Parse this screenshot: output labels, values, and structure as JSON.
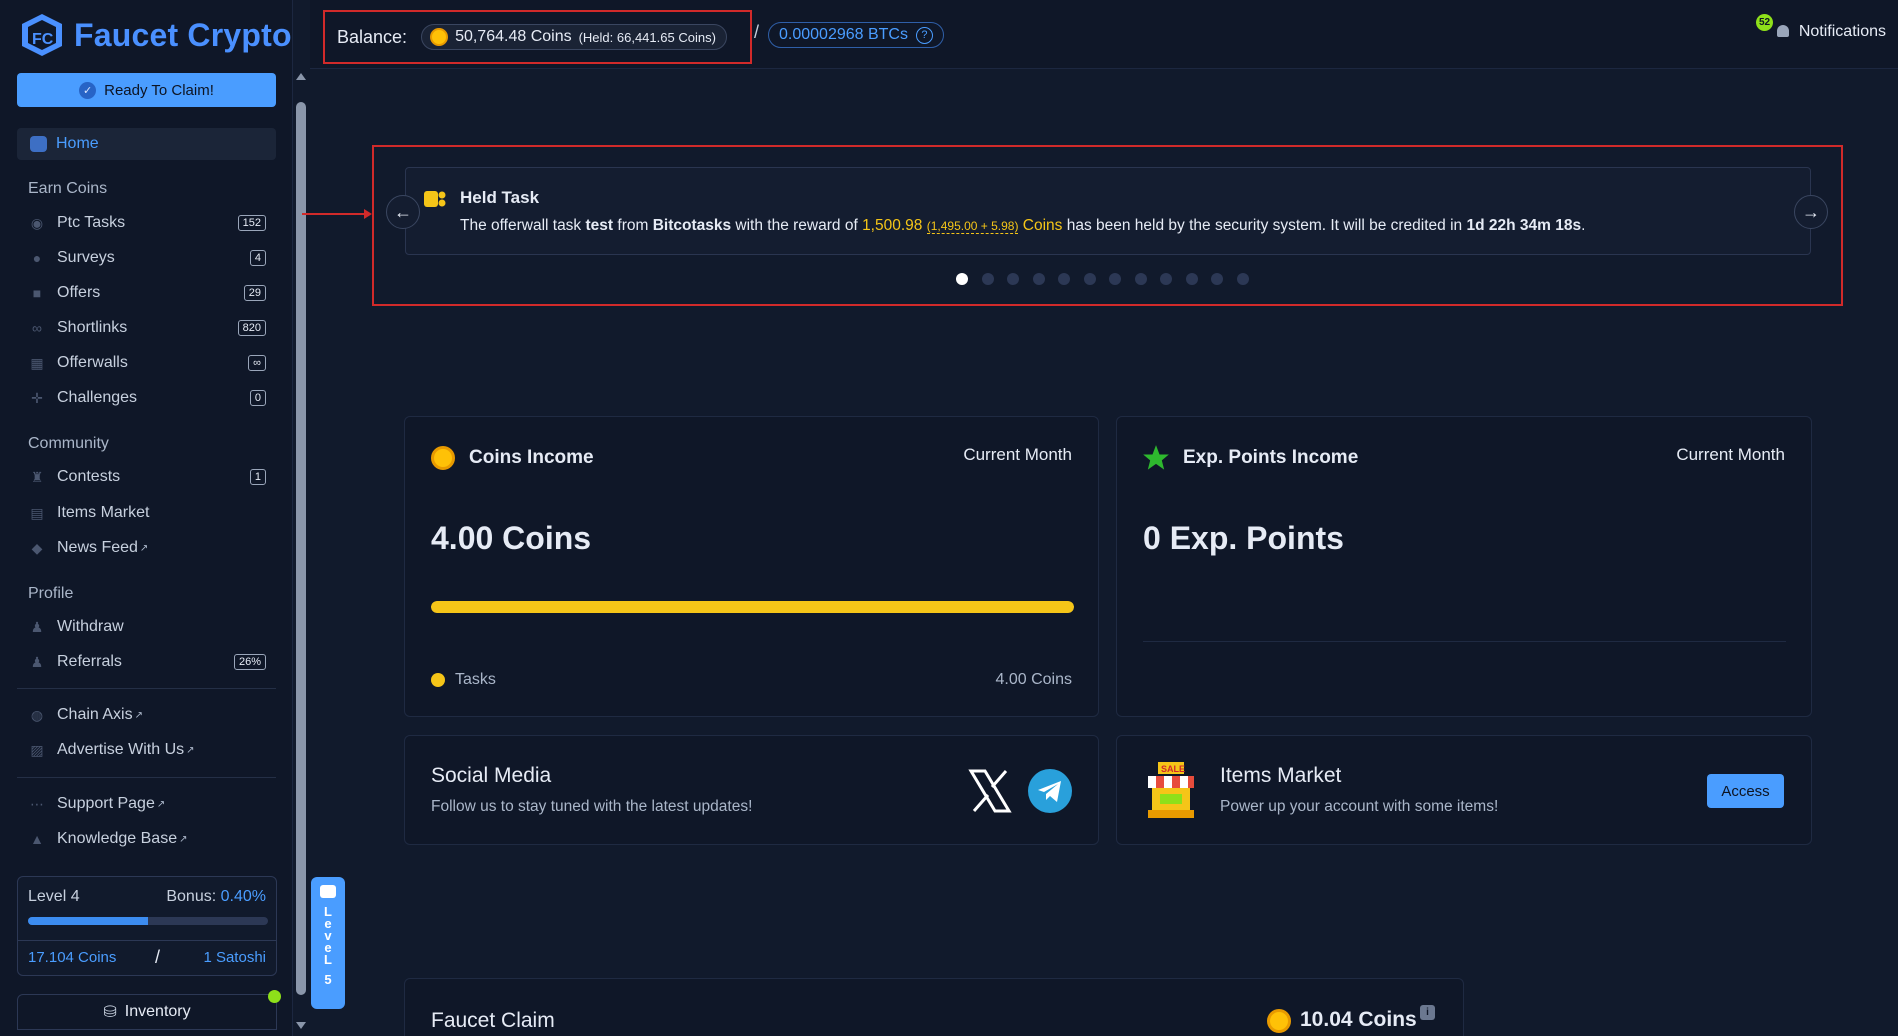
{
  "brand": {
    "name": "Faucet Crypto"
  },
  "sidebar": {
    "ready_button": "Ready To Claim!",
    "home": "Home",
    "sections": {
      "earn": "Earn Coins",
      "community": "Community",
      "profile": "Profile"
    },
    "earn_items": [
      {
        "label": "Ptc Tasks",
        "badge": "152"
      },
      {
        "label": "Surveys",
        "badge": "4"
      },
      {
        "label": "Offers",
        "badge": "29"
      },
      {
        "label": "Shortlinks",
        "badge": "820"
      },
      {
        "label": "Offerwalls",
        "badge": "∞"
      },
      {
        "label": "Challenges",
        "badge": "0"
      }
    ],
    "community_items": [
      {
        "label": "Contests",
        "badge": "1"
      },
      {
        "label": "Items Market"
      },
      {
        "label": "News Feed",
        "ext": "↗"
      }
    ],
    "profile_items": [
      {
        "label": "Withdraw"
      },
      {
        "label": "Referrals",
        "badge": "26%"
      }
    ],
    "extra_items": [
      {
        "label": "Chain Axis",
        "ext": "↗"
      },
      {
        "label": "Advertise With Us",
        "ext": "↗"
      }
    ],
    "support_items": [
      {
        "label": "Support Page",
        "ext": "↗"
      },
      {
        "label": "Knowledge Base",
        "ext": "↗"
      }
    ],
    "level": {
      "label": "Level 4",
      "bonus_label": "Bonus:",
      "bonus_value": "0.40%",
      "progress": 0.5,
      "coins": "17.104 Coins",
      "slash": "/",
      "satoshi": "1 Satoshi"
    },
    "inventory": "Inventory"
  },
  "topbar": {
    "balance_label": "Balance:",
    "coins": "50,764.48 Coins",
    "held": "(Held: 66,441.65 Coins)",
    "slash": "/",
    "btc": "0.00002968 BTCs",
    "btc_help": "?",
    "notifications_label": "Notifications",
    "notifications_count": "52"
  },
  "held_task": {
    "title": "Held Task",
    "text_1": "The offerwall task ",
    "task": "test",
    "text_2": " from ",
    "provider": "Bitcotasks",
    "text_3": " with the reward of ",
    "amount": "1,500.98",
    "breakdown": "(1,495.00 + 5.98)",
    "coins_word": "Coins",
    "text_4": " has been held by the security system. It will be credited in ",
    "time": "1d 22h 34m 18s",
    "text_5": ".",
    "dots_count": 12,
    "active_dot": 0
  },
  "coins_income": {
    "title": "Coins Income",
    "period": "Current Month",
    "value": "4.00 Coins",
    "progress": 1.0,
    "legend_label": "Tasks",
    "legend_value": "4.00 Coins"
  },
  "exp_income": {
    "title": "Exp. Points Income",
    "period": "Current Month",
    "value": "0 Exp. Points"
  },
  "social": {
    "title": "Social Media",
    "subtitle": "Follow us to stay tuned with the latest updates!"
  },
  "market": {
    "title": "Items Market",
    "subtitle": "Power up your account with some items!",
    "button": "Access",
    "sign": "SALE"
  },
  "faucet": {
    "title": "Faucet Claim",
    "value": "10.04 Coins",
    "info": "i"
  },
  "chat_tab": {
    "letters": [
      "L",
      "e",
      "v",
      "e",
      "L",
      "5"
    ]
  },
  "colors": {
    "accent": "#4a9dff",
    "gold": "#f5c518",
    "alert": "#d12a2a",
    "green": "#8ee01a"
  }
}
